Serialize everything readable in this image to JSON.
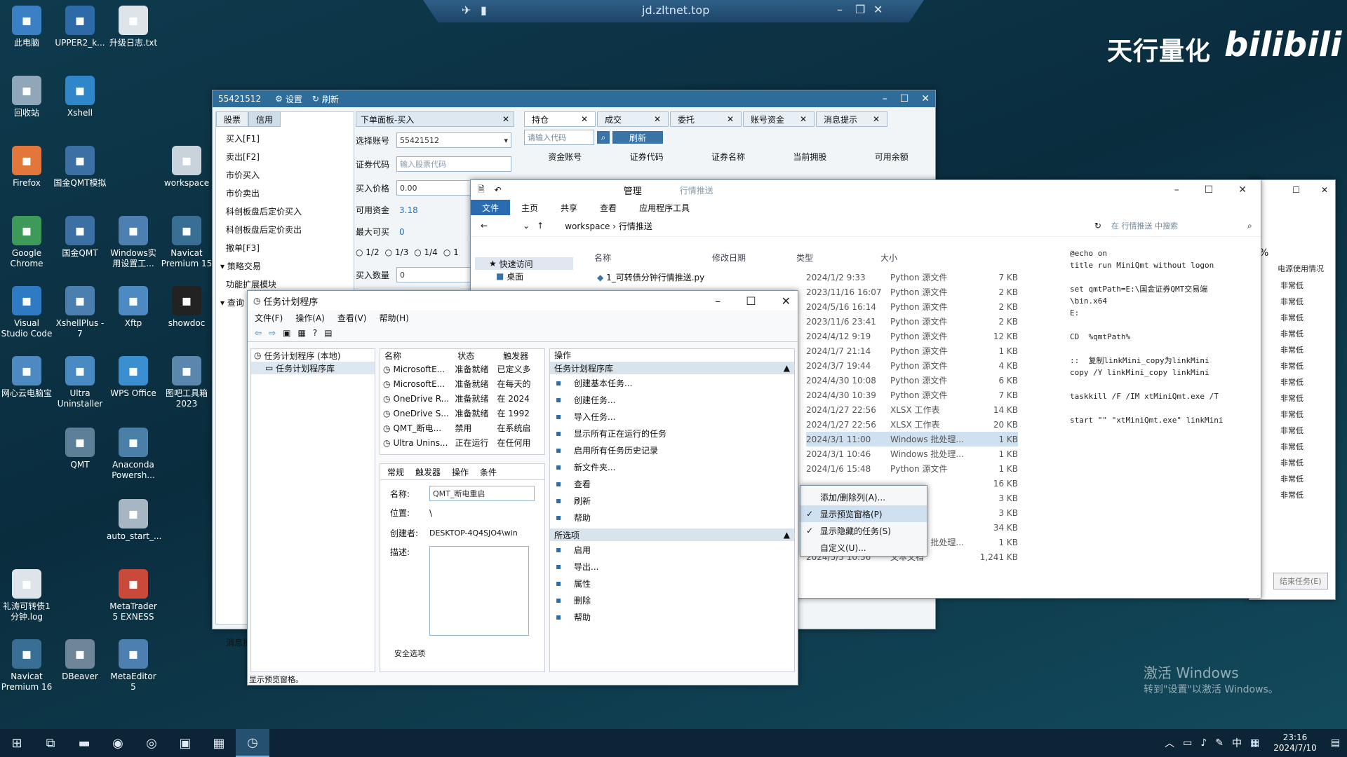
{
  "remote_bar": {
    "title": "jd.zltnet.top"
  },
  "brand": {
    "text": "天行量化",
    "logo": "bilibili"
  },
  "desktop_icons": [
    {
      "label": "此电脑",
      "x": 0
    },
    {
      "label": "UPPER2_k...",
      "x": 0
    },
    {
      "label": "升级日志.txt",
      "x": 0
    },
    {
      "label": "回收站",
      "x": 0
    },
    {
      "label": "Xshell",
      "x": 0
    },
    {
      "label": "Firefox",
      "x": 0
    },
    {
      "label": "国金QMT模拟",
      "x": 0
    },
    {
      "label": "workspace",
      "x": 0
    },
    {
      "label": "Google Chrome",
      "x": 0
    },
    {
      "label": "国金QMT",
      "x": 0
    },
    {
      "label": "Windows实用设置工...",
      "x": 0
    },
    {
      "label": "Navicat Premium 15",
      "x": 0
    },
    {
      "label": "Visual Studio Code",
      "x": 0
    },
    {
      "label": "XshellPlus - 7",
      "x": 0
    },
    {
      "label": "Xftp",
      "x": 0
    },
    {
      "label": "showdoc",
      "x": 0
    },
    {
      "label": "网心云电脑宝",
      "x": 0
    },
    {
      "label": "Ultra Uninstaller",
      "x": 0
    },
    {
      "label": "WPS Office",
      "x": 0
    },
    {
      "label": "图吧工具箱2023",
      "x": 0
    },
    {
      "label": "QMT",
      "x": 0
    },
    {
      "label": "Anaconda Powersh...",
      "x": 0
    },
    {
      "label": "auto_start_...",
      "x": 0
    },
    {
      "label": "礼涛可转债1分钟.log",
      "x": 0
    },
    {
      "label": "MetaTrader 5 EXNESS",
      "x": 0
    },
    {
      "label": "Navicat Premium 16",
      "x": 0
    },
    {
      "label": "DBeaver",
      "x": 0
    },
    {
      "label": "MetaEditor 5",
      "x": 0
    }
  ],
  "trade_window": {
    "title": "55421512",
    "settings": "设置",
    "refresh": "刷新",
    "left_tabs": [
      "股票",
      "信用"
    ],
    "left_items": [
      "买入[F1]",
      "卖出[F2]",
      "市价买入",
      "市价卖出",
      "科创板盘后定价买入",
      "科创板盘后定价卖出",
      "撤单[F3]",
      "策略交易",
      "功能扩展模块",
      "查询"
    ],
    "order_tab": "下单面板-买入",
    "account_label": "选择账号",
    "account_value": "55421512",
    "code_label": "证券代码",
    "code_placeholder": "输入股票代码",
    "price_label": "买入价格",
    "price_value": "0.00",
    "funds_label": "可用资金",
    "funds_value": "3.18",
    "max_label": "最大可买",
    "max_value": "0",
    "ratios": [
      "1/2",
      "1/3",
      "1/4",
      "1"
    ],
    "qty_label": "买入数量",
    "qty_value": "0",
    "msg_label": "消息推",
    "right_tabs": [
      "持仓",
      "成交",
      "委托",
      "账号资金",
      "消息提示"
    ],
    "search_placeholder": "请输入代码",
    "refresh_btn": "刷新",
    "columns": [
      "资金账号",
      "证券代码",
      "证券名称",
      "当前拥股",
      "可用余额"
    ]
  },
  "explorer": {
    "manage": "管理",
    "context": "行情推送",
    "ribbon": [
      "文件",
      "主页",
      "共享",
      "查看",
      "应用程序工具"
    ],
    "path": [
      "workspace",
      "行情推送"
    ],
    "search_placeholder": "在 行情推送 中搜索",
    "quick_access": "快速访问",
    "desktop": "桌面",
    "columns": [
      "名称",
      "修改日期",
      "类型",
      "大小"
    ],
    "first_file": "1_可转债分钟行情推送.py",
    "rows": [
      {
        "date": "2024/1/2 9:33",
        "type": "Python 源文件",
        "size": "7 KB"
      },
      {
        "date": "2023/11/16 16:07",
        "type": "Python 源文件",
        "size": "2 KB"
      },
      {
        "date": "2024/5/16 16:14",
        "type": "Python 源文件",
        "size": "2 KB"
      },
      {
        "date": "2023/11/6 23:41",
        "type": "Python 源文件",
        "size": "2 KB"
      },
      {
        "date": "2024/4/12 9:19",
        "type": "Python 源文件",
        "size": "12 KB"
      },
      {
        "date": "2024/1/7 21:14",
        "type": "Python 源文件",
        "size": "1 KB"
      },
      {
        "date": "2024/3/7 19:44",
        "type": "Python 源文件",
        "size": "4 KB"
      },
      {
        "date": "2024/4/30 10:08",
        "type": "Python 源文件",
        "size": "6 KB"
      },
      {
        "date": "2024/4/30 10:39",
        "type": "Python 源文件",
        "size": "7 KB"
      },
      {
        "date": "2024/1/27 22:56",
        "type": "XLSX 工作表",
        "size": "14 KB"
      },
      {
        "date": "2024/1/27 22:56",
        "type": "XLSX 工作表",
        "size": "20 KB"
      },
      {
        "date": "2024/3/1 11:00",
        "type": "Windows 批处理...",
        "size": "1 KB"
      },
      {
        "date": "2024/3/1 10:46",
        "type": "Windows 批处理...",
        "size": "1 KB"
      },
      {
        "date": "2024/1/6 15:48",
        "type": "Python 源文件",
        "size": "1 KB"
      },
      {
        "date": "",
        "type": "",
        "size": "16 KB"
      },
      {
        "date": "",
        "type": "",
        "size": "3 KB"
      },
      {
        "date": "",
        "type": "",
        "size": "3 KB"
      },
      {
        "date": "",
        "type": "",
        "size": "34 KB"
      },
      {
        "date": "",
        "type": "Windows 批处理...",
        "size": "1 KB"
      },
      {
        "date": "2024/5/5 10:56",
        "type": "文本文档",
        "size": "1,241 KB"
      }
    ],
    "preview_lines": [
      "@echo on",
      "title run MiniQmt without logon",
      "",
      "set qmtPath=E:\\国金证券QMT交易端",
      "\\bin.x64",
      "E:",
      "",
      "CD  %qmtPath%",
      "",
      "::  复制linkMini_copy为linkMini",
      "copy /Y linkMini_copy linkMini",
      "",
      "taskkill /F /IM xtMiniQmt.exe /T",
      "",
      "start \"\" \"xtMiniQmt.exe\" linkMini"
    ]
  },
  "taskmgr": {
    "percent": "%",
    "column": "电源使用情况",
    "values": [
      "非常低",
      "非常低",
      "非常低",
      "非常低",
      "非常低",
      "非常低",
      "非常低",
      "非常低",
      "非常低",
      "非常低",
      "非常低",
      "非常低",
      "非常低",
      "非常低"
    ],
    "end_task": "结束任务(E)"
  },
  "scheduler": {
    "title": "任务计划程序",
    "menu": [
      "文件(F)",
      "操作(A)",
      "查看(V)",
      "帮助(H)"
    ],
    "tree": [
      "任务计划程序 (本地)",
      "任务计划程序库"
    ],
    "task_columns": [
      "名称",
      "状态",
      "触发器"
    ],
    "tasks": [
      {
        "name": "MicrosoftE...",
        "status": "准备就绪",
        "trigger": "已定义多"
      },
      {
        "name": "MicrosoftE...",
        "status": "准备就绪",
        "trigger": "在每天的"
      },
      {
        "name": "OneDrive R...",
        "status": "准备就绪",
        "trigger": "在 2024"
      },
      {
        "name": "OneDrive S...",
        "status": "准备就绪",
        "trigger": "在 1992"
      },
      {
        "name": "QMT_断电...",
        "status": "禁用",
        "trigger": "在系统启"
      },
      {
        "name": "Ultra Unins...",
        "status": "正在运行",
        "trigger": "在任何用"
      }
    ],
    "detail_tabs": [
      "常规",
      "触发器",
      "操作",
      "条件"
    ],
    "name_label": "名称:",
    "name_value": "QMT_断电重启",
    "location_label": "位置:",
    "location_value": "\\",
    "author_label": "创建者:",
    "author_value": "DESKTOP-4Q4SJO4\\win",
    "desc_label": "描述:",
    "security_label": "安全选项",
    "actions_header": "操作",
    "actions_group1": "任务计划程序库",
    "actions1": [
      "创建基本任务...",
      "创建任务...",
      "导入任务...",
      "显示所有正在运行的任务",
      "启用所有任务历史记录",
      "新文件夹...",
      "查看",
      "刷新",
      "帮助"
    ],
    "actions_group2": "所选项",
    "actions2": [
      "启用",
      "导出...",
      "属性",
      "删除",
      "帮助"
    ],
    "status_bar": "显示预览窗格。"
  },
  "context_menu": {
    "items": [
      "添加/删除列(A)...",
      "显示预览窗格(P)",
      "显示隐藏的任务(S)",
      "自定义(U)..."
    ]
  },
  "watermark": {
    "line1": "激活 Windows",
    "line2": "转到\"设置\"以激活 Windows。"
  },
  "taskbar": {
    "time": "23:16",
    "date": "2024/7/10",
    "ime": "中"
  }
}
